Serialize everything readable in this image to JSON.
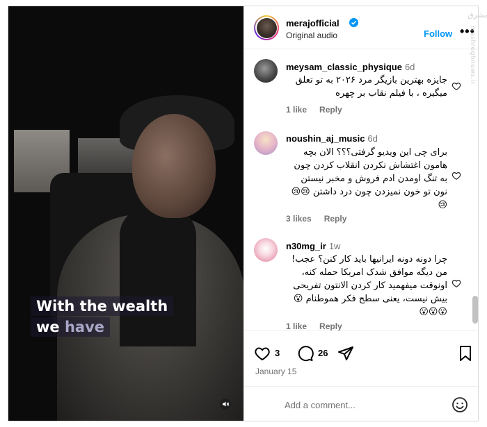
{
  "post": {
    "username": "merajofficial",
    "subtitle": "Original audio",
    "follow_label": "Follow",
    "more_label": "•••"
  },
  "video": {
    "caption_line1": "With the wealth",
    "caption_line2_a": "we",
    "caption_line2_b": "have"
  },
  "comments": [
    {
      "username": "meysam_classic_physique",
      "time": "6d",
      "text": "جایزه بهترین بازیگر مرد ۲۰۲۶ به تو تعلق میگیره ، با فیلم نقاب بر چهره",
      "likes": "1 like",
      "reply": "Reply"
    },
    {
      "username": "noushin_aj_music",
      "time": "6d",
      "text": "برای چی این ویدیو گرفتی؟؟؟ الان بچه هامون اغتشاش نکردن انقلاب کردن چون به تنگ اومدن ادم فروش و مخبر نیستن نون تو خون نمیزدن چون درد داشتن 😢😢😢",
      "likes": "3 likes",
      "reply": "Reply"
    },
    {
      "username": "n30mg_ir",
      "time": "1w",
      "text": "چرا دونه دونه ایرانیها باید کار کنن؟ عجب! من دیگه موافق شدک امریکا حمله کنه، اونوقت میفهمید کار کردن الانتون تفریحی بیش نیست، یعنی سطح فکر هموطنام 😮😮😮😮",
      "likes": "1 like",
      "reply": "Reply"
    }
  ],
  "actions": {
    "like_count": "3",
    "comment_count": "26",
    "date": "January 15"
  },
  "add_comment": {
    "placeholder": "Add a comment..."
  },
  "watermark": {
    "logo_text": "مشرق",
    "site_text": "mashreghnews.ir"
  },
  "colors": {
    "link_blue": "#0095f6",
    "verified_blue": "#0095f6",
    "muted_text": "#737373",
    "divider": "#efefef"
  }
}
